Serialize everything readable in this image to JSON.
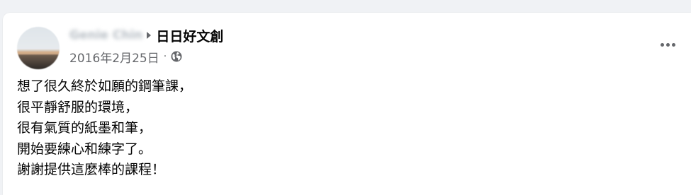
{
  "post": {
    "author_name": "Genie Chin",
    "group_name": "日日好文創",
    "date": "2016年2月25日",
    "separator": "·",
    "privacy_icon": "globe-icon",
    "more_icon": "more-horizontal-icon",
    "lines": [
      "想了很久終於如願的鋼筆課，",
      "很平靜舒服的環境，",
      "很有氣質的紙墨和筆，",
      "開始要練心和練字了。",
      "謝謝提供這麼棒的課程！"
    ]
  },
  "colors": {
    "background": "#f0f2f5",
    "card": "#ffffff",
    "text_primary": "#050505",
    "text_secondary": "#65676b"
  }
}
